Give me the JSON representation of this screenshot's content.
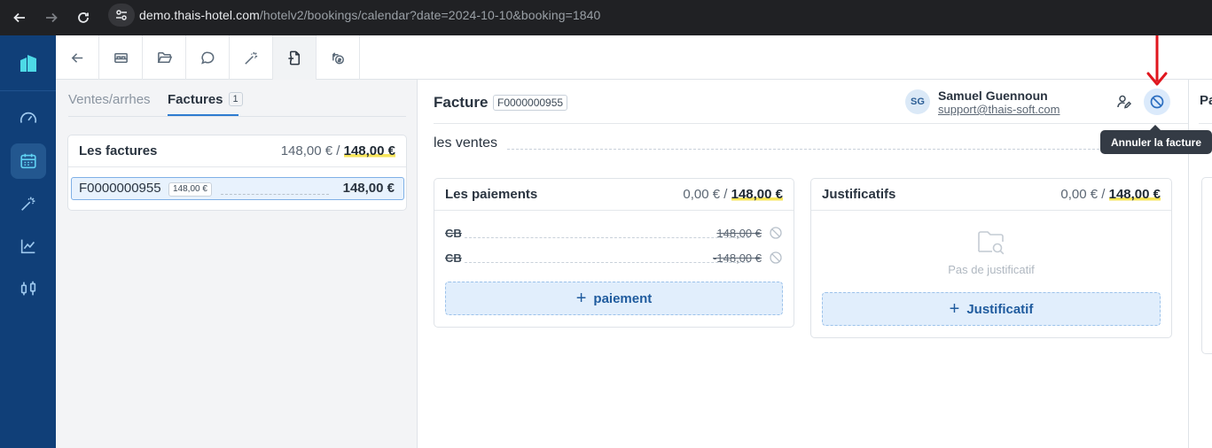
{
  "browser": {
    "url_host": "demo.thais-hotel.com",
    "url_path": "/hotelv2/bookings/calendar?date=2024-10-10&booking=1840"
  },
  "sidebar": {
    "items": [
      {
        "icon": "gauge-icon"
      },
      {
        "icon": "calendar-icon",
        "active": true
      },
      {
        "icon": "magic-wand-icon"
      },
      {
        "icon": "line-chart-icon"
      },
      {
        "icon": "sliders-icon"
      }
    ]
  },
  "toolbar": {
    "buttons": [
      {
        "icon": "back-arrow-icon"
      },
      {
        "icon": "bed-icon"
      },
      {
        "icon": "folder-open-icon"
      },
      {
        "icon": "chat-bubble-icon"
      },
      {
        "icon": "magic-wand-icon"
      },
      {
        "icon": "file-plus-icon",
        "active": true
      },
      {
        "icon": "refund-icon"
      }
    ]
  },
  "left": {
    "tabs": [
      {
        "label": "Ventes/arrhes"
      },
      {
        "label": "Factures",
        "count": "1",
        "active": true
      }
    ],
    "card": {
      "title": "Les factures",
      "amount_paid": "148,00 €",
      "separator": "/",
      "amount_total": "148,00 €",
      "rows": [
        {
          "number": "F0000000955",
          "badge": "148,00 €",
          "amount": "148,00 €"
        }
      ]
    }
  },
  "invoice": {
    "title": "Facture",
    "number": "F0000000955",
    "user": {
      "initials": "SG",
      "name": "Samuel Guennoun",
      "email": "support@thais-soft.com"
    },
    "ventes_label": "les ventes",
    "payments": {
      "title": "Les paiements",
      "amount_paid": "0,00 €",
      "separator": "/",
      "amount_total": "148,00 €",
      "lines": [
        {
          "label": "CB",
          "value": "148,00 €"
        },
        {
          "label": "CB",
          "value": "-148,00 €"
        }
      ],
      "add_label": "paiement"
    },
    "justificatifs": {
      "title": "Justificatifs",
      "amount_paid": "0,00 €",
      "separator": "/",
      "amount_total": "148,00 €",
      "empty_text": "Pas de justificatif",
      "add_label": "Justificatif"
    }
  },
  "right": {
    "title_partial": "Pa"
  },
  "tooltip": {
    "text": "Annuler la facture"
  },
  "colors": {
    "sidebar_bg": "#103f78",
    "accent": "#2d7bd0",
    "highlight": "#f7e55a",
    "annotation_arrow": "#e0161e"
  }
}
